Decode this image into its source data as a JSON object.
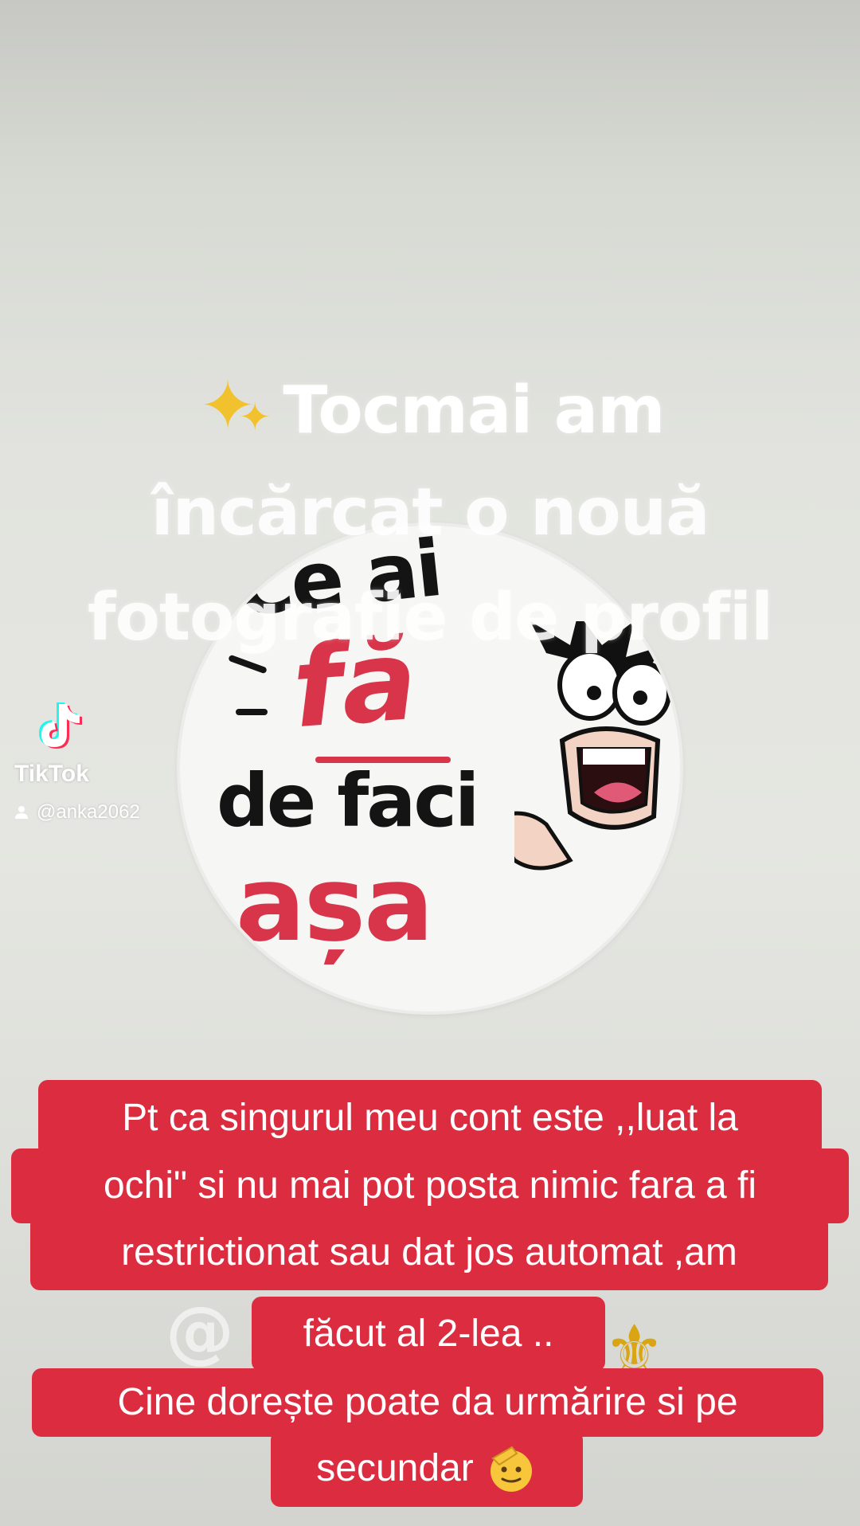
{
  "overlay": {
    "sparkle_icon": "sparkles-icon",
    "lines": [
      "Tocmai am",
      "încărcat o nouă",
      "fotografie de profil"
    ]
  },
  "profile_picture": {
    "sticker_lines": [
      "Ce ai",
      "fă",
      "de faci",
      "așa"
    ]
  },
  "watermark": {
    "brand": "TikTok",
    "username": "@anka2062",
    "logo_icon": "tiktok-logo-icon",
    "user_icon": "user-icon"
  },
  "caption": {
    "lines": [
      "Pt ca singurul meu cont este ,,luat la",
      "ochi\" si nu mai pot posta nimic fara a fi",
      "restrictionat sau dat jos automat ,am",
      "făcut al 2-lea ..",
      "Cine dorește poate da urmărire si pe",
      "secundar"
    ],
    "trailing_emoji": "saluting-face-icon",
    "background_color": "#dc2d40"
  },
  "background_elements": {
    "faded_text": "@",
    "fleur_icon": "fleur-de-lis-icon"
  }
}
